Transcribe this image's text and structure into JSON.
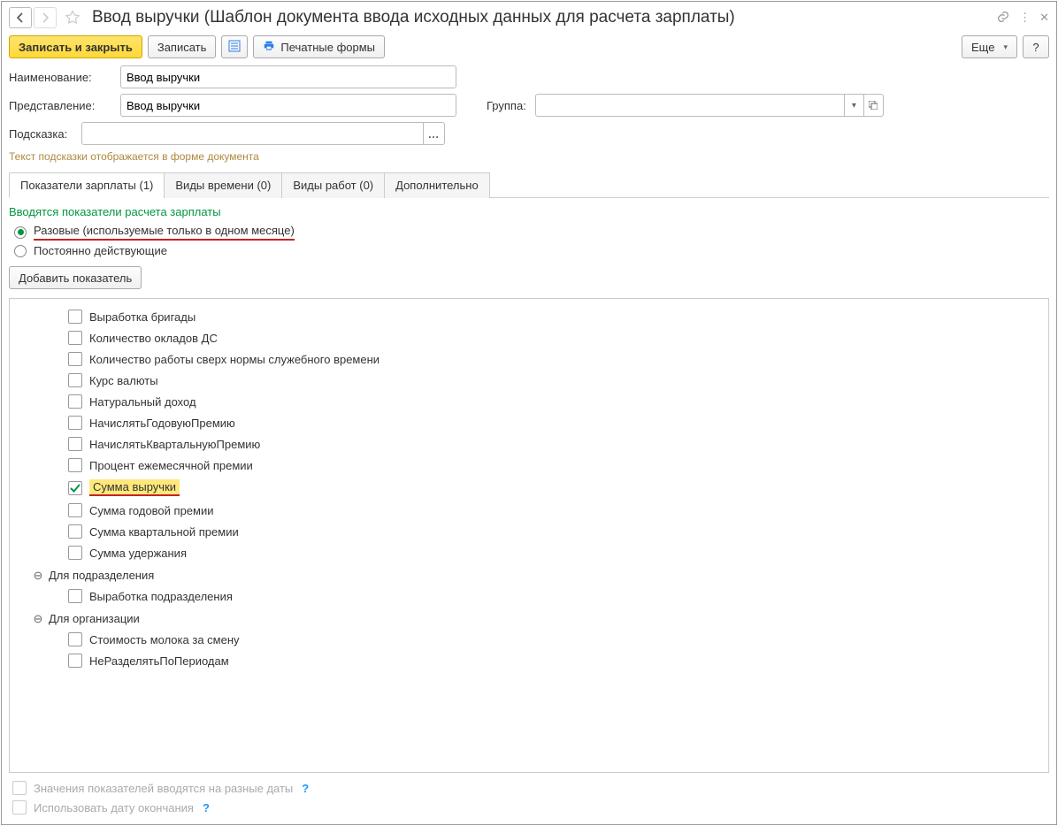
{
  "title": "Ввод выручки (Шаблон документа ввода исходных данных для расчета зарплаты)",
  "toolbar": {
    "save_close": "Записать и закрыть",
    "save": "Записать",
    "print_forms": "Печатные формы",
    "more": "Еще",
    "help": "?"
  },
  "fields": {
    "name_label": "Наименование:",
    "name_value": "Ввод выручки",
    "repr_label": "Представление:",
    "repr_value": "Ввод выручки",
    "group_label": "Группа:",
    "group_value": "",
    "hint_label": "Подсказка:",
    "hint_value": "",
    "hint_note": "Текст подсказки отображается в форме документа"
  },
  "tabs": [
    {
      "label": "Показатели зарплаты (1)",
      "active": true
    },
    {
      "label": "Виды времени (0)",
      "active": false
    },
    {
      "label": "Виды работ (0)",
      "active": false
    },
    {
      "label": "Дополнительно",
      "active": false
    }
  ],
  "section": {
    "title": "Вводятся показатели расчета зарплаты",
    "radio_once": "Разовые (используемые только в одном месяце)",
    "radio_permanent": "Постоянно действующие",
    "add_button": "Добавить показатель"
  },
  "tree": {
    "items": [
      {
        "label": "Выработка бригады",
        "checked": false
      },
      {
        "label": "Количество окладов ДС",
        "checked": false
      },
      {
        "label": "Количество работы сверх нормы служебного времени",
        "checked": false
      },
      {
        "label": "Курс валюты",
        "checked": false
      },
      {
        "label": "Натуральный доход",
        "checked": false
      },
      {
        "label": "НачислятьГодовуюПремию",
        "checked": false
      },
      {
        "label": "НачислятьКвартальнуюПремию",
        "checked": false
      },
      {
        "label": "Процент ежемесячной премии",
        "checked": false
      },
      {
        "label": "Сумма выручки",
        "checked": true,
        "highlight": true
      },
      {
        "label": "Сумма годовой премии",
        "checked": false
      },
      {
        "label": "Сумма квартальной премии",
        "checked": false
      },
      {
        "label": "Сумма удержания",
        "checked": false
      }
    ],
    "group_dept": "Для подразделения",
    "dept_items": [
      {
        "label": "Выработка подразделения",
        "checked": false
      }
    ],
    "group_org": "Для организации",
    "org_items": [
      {
        "label": "Стоимость молока за смену",
        "checked": false
      },
      {
        "label": "НеРазделятьПоПериодам",
        "checked": false
      }
    ]
  },
  "footer": {
    "dates_check": "Значения показателей вводятся на разные даты",
    "end_date_check": "Использовать дату окончания"
  }
}
